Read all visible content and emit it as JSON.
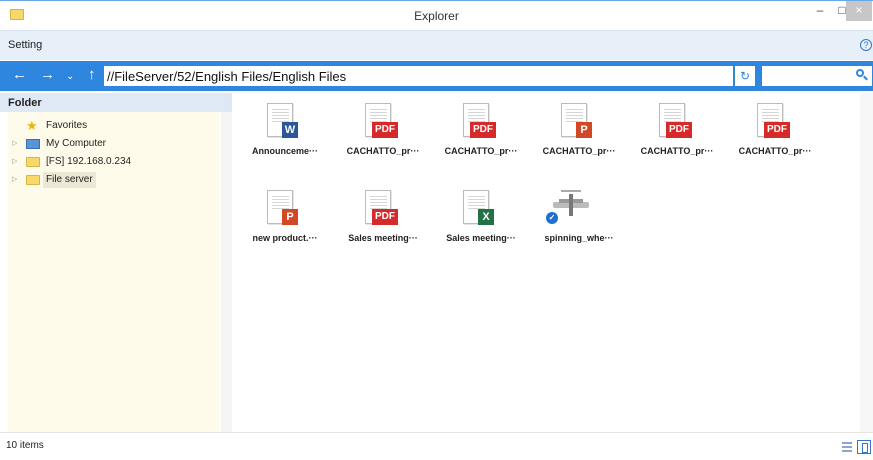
{
  "window": {
    "title": "Explorer",
    "min_glyph": "–",
    "max_glyph": "□",
    "close_glyph": "×"
  },
  "menu": {
    "setting": "Setting",
    "help_glyph": "?"
  },
  "nav": {
    "back": "←",
    "forward": "→",
    "history": "⌄",
    "up": "↑",
    "path": "//FileServer/52/English Files/English Files",
    "refresh_glyph": "↻",
    "search_value": ""
  },
  "sidebar": {
    "header": "Folder",
    "items": [
      {
        "label": "Favorites",
        "icon": "star-icon",
        "has_arrow": false
      },
      {
        "label": "My Computer",
        "icon": "computer-icon",
        "has_arrow": true
      },
      {
        "label": "[FS] 192.168.0.234",
        "icon": "folder-icon",
        "has_arrow": true
      },
      {
        "label": "File server",
        "icon": "folder-icon",
        "has_arrow": true,
        "selected": true
      }
    ],
    "arrow_glyph": "▷"
  },
  "files": [
    {
      "name": "Announceme···",
      "type": "word",
      "badge": "W"
    },
    {
      "name": "CACHATTO_pr···",
      "type": "pdf",
      "badge": "PDF"
    },
    {
      "name": "CACHATTO_pr···",
      "type": "pdf",
      "badge": "PDF"
    },
    {
      "name": "CACHATTO_pr···",
      "type": "powerpoint",
      "badge": "P"
    },
    {
      "name": "CACHATTO_pr···",
      "type": "pdf",
      "badge": "PDF"
    },
    {
      "name": "CACHATTO_pr···",
      "type": "pdf",
      "badge": "PDF"
    },
    {
      "name": "new product.···",
      "type": "powerpoint",
      "badge": "P"
    },
    {
      "name": "Sales meeting···",
      "type": "pdf",
      "badge": "PDF"
    },
    {
      "name": "Sales meeting···",
      "type": "excel",
      "badge": "X"
    },
    {
      "name": "spinning_whe···",
      "type": "image",
      "badge": "✓"
    }
  ],
  "status": {
    "item_count": "10 items"
  },
  "colors": {
    "accent": "#2e86de",
    "pdf": "#d62929",
    "word": "#2b579a",
    "powerpoint": "#d24726",
    "excel": "#217346",
    "folder": "#f6d96a"
  }
}
